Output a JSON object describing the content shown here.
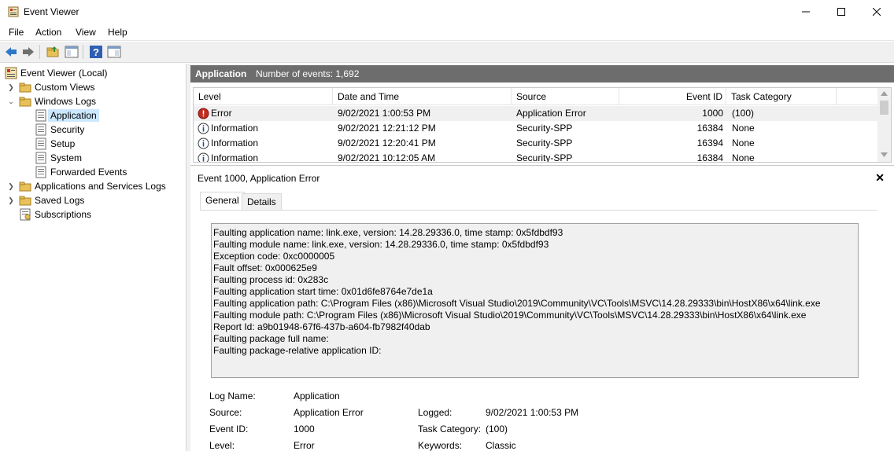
{
  "window": {
    "title": "Event Viewer",
    "minimize_icon": "minimize-icon",
    "maximize_icon": "maximize-icon",
    "close_icon": "close-icon"
  },
  "menu": [
    "File",
    "Action",
    "View",
    "Help"
  ],
  "tree": {
    "root": "Event Viewer (Local)",
    "custom_views": "Custom Views",
    "windows_logs": "Windows Logs",
    "application": "Application",
    "security": "Security",
    "setup": "Setup",
    "system": "System",
    "forwarded_events": "Forwarded Events",
    "app_services_logs": "Applications and Services Logs",
    "saved_logs": "Saved Logs",
    "subscriptions": "Subscriptions"
  },
  "panel": {
    "title": "Application",
    "count_label": "Number of events: 1,692"
  },
  "events": {
    "columns": [
      "Level",
      "Date and Time",
      "Source",
      "Event ID",
      "Task Category"
    ],
    "rows": [
      {
        "level": "Error",
        "date": "9/02/2021 1:00:53 PM",
        "source": "Application Error",
        "id": "1000",
        "category": "(100)"
      },
      {
        "level": "Information",
        "date": "9/02/2021 12:21:12 PM",
        "source": "Security-SPP",
        "id": "16384",
        "category": "None"
      },
      {
        "level": "Information",
        "date": "9/02/2021 12:20:41 PM",
        "source": "Security-SPP",
        "id": "16394",
        "category": "None"
      },
      {
        "level": "Information",
        "date": "9/02/2021 10:12:05 AM",
        "source": "Security-SPP",
        "id": "16384",
        "category": "None"
      }
    ]
  },
  "detail": {
    "title": "Event 1000, Application Error",
    "tabs": [
      "General",
      "Details"
    ],
    "message_lines": [
      "Faulting application name: link.exe, version: 14.28.29336.0, time stamp: 0x5fdbdf93",
      "Faulting module name: link.exe, version: 14.28.29336.0, time stamp: 0x5fdbdf93",
      "Exception code: 0xc0000005",
      "Fault offset: 0x000625e9",
      "Faulting process id: 0x283c",
      "Faulting application start time: 0x01d6fe8764e7de1a",
      "Faulting application path: C:\\Program Files (x86)\\Microsoft Visual Studio\\2019\\Community\\VC\\Tools\\MSVC\\14.28.29333\\bin\\HostX86\\x64\\link.exe",
      "Faulting module path: C:\\Program Files (x86)\\Microsoft Visual Studio\\2019\\Community\\VC\\Tools\\MSVC\\14.28.29333\\bin\\HostX86\\x64\\link.exe",
      "Report Id: a9b01948-67f6-437b-a604-fb7982f40dab",
      "Faulting package full name:",
      "Faulting package-relative application ID:"
    ],
    "props": {
      "log_name_label": "Log Name:",
      "log_name": "Application",
      "source_label": "Source:",
      "source": "Application Error",
      "logged_label": "Logged:",
      "logged": "9/02/2021 1:00:53 PM",
      "event_id_label": "Event ID:",
      "event_id": "1000",
      "task_category_label": "Task Category:",
      "task_category": "(100)",
      "level_label": "Level:",
      "level": "Error",
      "keywords_label": "Keywords:",
      "keywords": "Classic"
    }
  }
}
